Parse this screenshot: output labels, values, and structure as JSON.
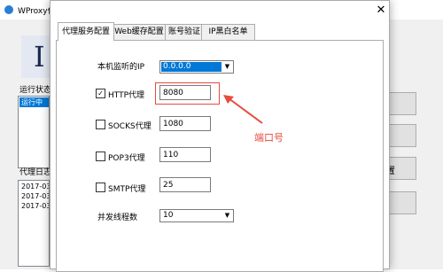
{
  "main_window": {
    "title": "WProxy代",
    "logo_text": "I",
    "status_label": "运行状态",
    "status_item": "运行中",
    "log_label": "代理日志",
    "log_lines": [
      "2017-03-",
      "2017-03-",
      "2017-03-"
    ],
    "right_button_text": "置"
  },
  "dialog": {
    "tabs": [
      "代理服务配置",
      "Web缓存配置",
      "账号验证",
      "IP黑白名单"
    ],
    "active_tab_index": 0,
    "listen_ip": {
      "label": "本机监听的IP",
      "value": "0.0.0.0"
    },
    "http": {
      "checked": true,
      "label": "HTTP代理",
      "value": "8080"
    },
    "socks": {
      "checked": false,
      "label": "SOCKS代理",
      "value": "1080"
    },
    "pop3": {
      "checked": false,
      "label": "POP3代理",
      "value": "110"
    },
    "smtp": {
      "checked": false,
      "label": "SMTP代理",
      "value": "25"
    },
    "threads": {
      "label": "并发线程数",
      "value": "10"
    }
  },
  "annotation": {
    "text": "端口号",
    "color": "#e74c3c"
  },
  "colors": {
    "selection": "#0078d7",
    "dialog_bg": "#ffffff",
    "window_bg": "#f0f0f0"
  },
  "icons": {
    "close": "close-icon",
    "dropdown": "chevron-down-icon",
    "check": "checkmark-icon"
  }
}
